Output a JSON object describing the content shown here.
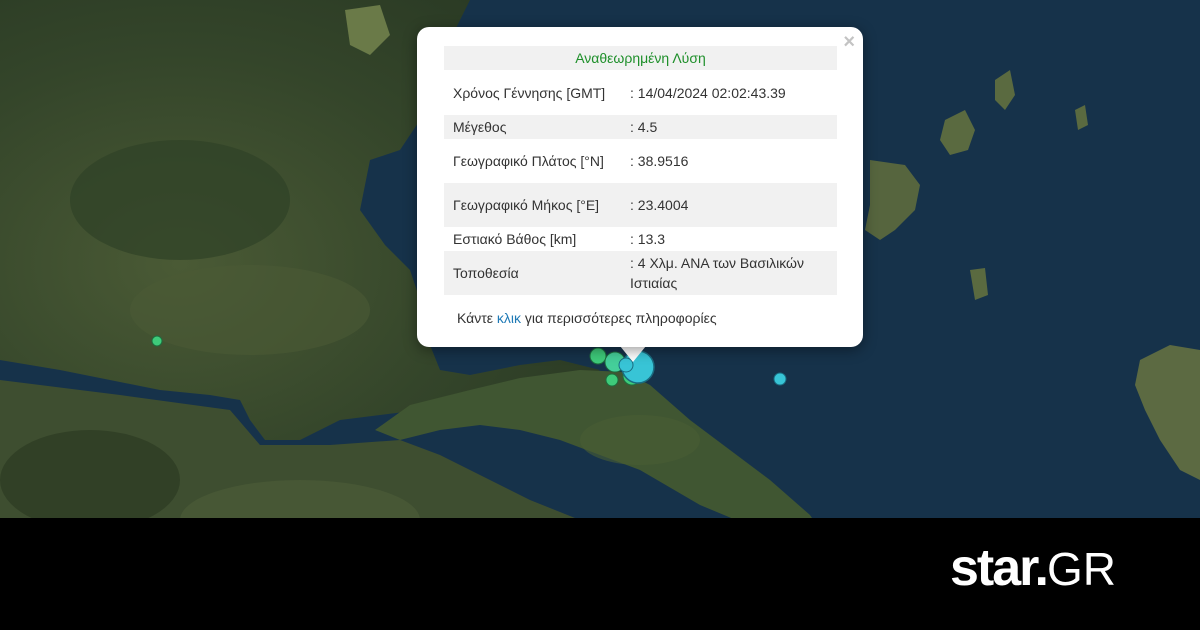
{
  "popup": {
    "close_icon": "×",
    "title": "Αναθεωρημένη Λύση",
    "rows": [
      {
        "label": "Χρόνος Γέννησης [GMT]",
        "value": ": 14/04/2024 02:02:43.39"
      },
      {
        "label": "Μέγεθος",
        "value": ": 4.5"
      },
      {
        "label": "Γεωγραφικό Πλάτος [°N]",
        "value": ": 38.9516"
      },
      {
        "label": "Γεωγραφικό Μήκος [°E]",
        "value": ": 23.4004"
      },
      {
        "label": "Εστιακό Βάθος [km]",
        "value": ": 13.3"
      },
      {
        "label": "Τοποθεσία",
        "value": ": 4 Χλμ. ΑΝΑ των Βασιλικών Ιστιαίας"
      }
    ],
    "more_prefix": "Κάντε ",
    "more_link": "κλικ",
    "more_suffix": " για περισσότερες πληροφορίες"
  },
  "colors": {
    "sea": "#16324a",
    "land": "#3b4d2c",
    "title_green": "#1e8f2a",
    "link_blue": "#1f7ab6",
    "quake_cyan": "#38c4d6",
    "quake_green": "#3ecb7a"
  },
  "logo": {
    "main": "star",
    "dot": ".",
    "suffix": "GR"
  }
}
